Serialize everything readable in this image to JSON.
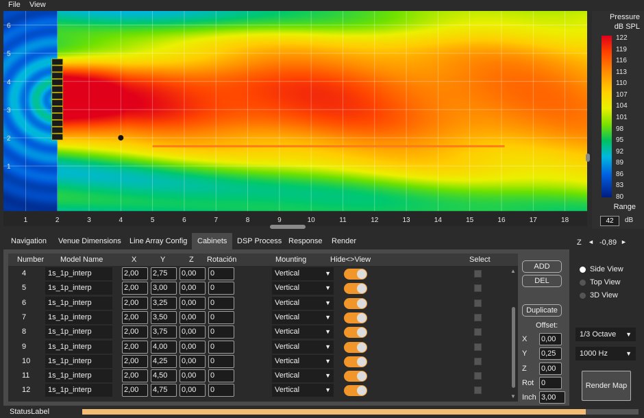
{
  "menu": [
    "File",
    "View"
  ],
  "map": {
    "x_ticks": [
      "1",
      "2",
      "3",
      "4",
      "5",
      "6",
      "7",
      "8",
      "9",
      "10",
      "11",
      "12",
      "13",
      "14",
      "15",
      "16",
      "17",
      "18"
    ],
    "y_ticks": [
      "6",
      "5",
      "4",
      "3",
      "2",
      "1"
    ],
    "x_range": [
      0.3,
      18.7
    ],
    "y_range": [
      -0.6,
      6.5
    ],
    "source_x": 2.0,
    "source_y_range": [
      1.9,
      4.8
    ],
    "source_elements": 12,
    "listener_point": [
      4.0,
      2.0
    ],
    "audience_line": {
      "x_start": 5.0,
      "x_end": 16.1,
      "y": 1.7
    }
  },
  "colorbar": {
    "title_line1": "Pressure",
    "title_line2": "dB SPL",
    "labels": [
      "122",
      "119",
      "116",
      "113",
      "110",
      "107",
      "104",
      "101",
      "98",
      "95",
      "92",
      "89",
      "86",
      "83",
      "80"
    ],
    "range_label": "Range",
    "range_value": "42",
    "range_unit": "dB"
  },
  "tabs": [
    "Navigation",
    "Venue Dimensions",
    "Line Array Config",
    "Cabinets",
    "DSP Process",
    "Response",
    "Render"
  ],
  "active_tab": "Cabinets",
  "z_control": {
    "label": "Z",
    "left": "◄",
    "value": "-0,89",
    "right": "►"
  },
  "table": {
    "headers": [
      "Number",
      "Model Name",
      "X",
      "Y",
      "Z",
      "Rotación",
      "Mounting",
      "Hide<>View",
      "Select"
    ],
    "rows": [
      {
        "num": "4",
        "model": "1s_1p_interp",
        "x": "2,00",
        "y": "2,75",
        "z": "0,00",
        "rot": "0",
        "mount": "Vertical"
      },
      {
        "num": "5",
        "model": "1s_1p_interp",
        "x": "2,00",
        "y": "3,00",
        "z": "0,00",
        "rot": "0",
        "mount": "Vertical"
      },
      {
        "num": "6",
        "model": "1s_1p_interp",
        "x": "2,00",
        "y": "3,25",
        "z": "0,00",
        "rot": "0",
        "mount": "Vertical"
      },
      {
        "num": "7",
        "model": "1s_1p_interp",
        "x": "2,00",
        "y": "3,50",
        "z": "0,00",
        "rot": "0",
        "mount": "Vertical"
      },
      {
        "num": "8",
        "model": "1s_1p_interp",
        "x": "2,00",
        "y": "3,75",
        "z": "0,00",
        "rot": "0",
        "mount": "Vertical"
      },
      {
        "num": "9",
        "model": "1s_1p_interp",
        "x": "2,00",
        "y": "4,00",
        "z": "0,00",
        "rot": "0",
        "mount": "Vertical"
      },
      {
        "num": "10",
        "model": "1s_1p_interp",
        "x": "2,00",
        "y": "4,25",
        "z": "0,00",
        "rot": "0",
        "mount": "Vertical"
      },
      {
        "num": "11",
        "model": "1s_1p_interp",
        "x": "2,00",
        "y": "4,50",
        "z": "0,00",
        "rot": "0",
        "mount": "Vertical"
      },
      {
        "num": "12",
        "model": "1s_1p_interp",
        "x": "2,00",
        "y": "4,75",
        "z": "0,00",
        "rot": "0",
        "mount": "Vertical"
      }
    ]
  },
  "buttons": {
    "add": "ADD",
    "del": "DEL",
    "duplicate": "Duplicate"
  },
  "offset": {
    "title": "Offset:",
    "x_label": "X",
    "x": "0,00",
    "y_label": "Y",
    "y": "0,25",
    "z_label": "Z",
    "z": "0,00",
    "rot_label": "Rot",
    "rot": "0",
    "inch_label": "Inch",
    "inch": "3,00"
  },
  "views": {
    "side": "Side View",
    "top": "Top View",
    "three_d": "3D View",
    "selected": "Side View"
  },
  "octave_select": "1/3 Octave",
  "freq_select": "1000 Hz",
  "render_button": "Render Map",
  "status": {
    "label": "StatusLabel",
    "progress": 0.905
  },
  "colors": {
    "accent": "#f0962a",
    "progress": "#f4bd73",
    "panel": "#4a4a4a"
  }
}
